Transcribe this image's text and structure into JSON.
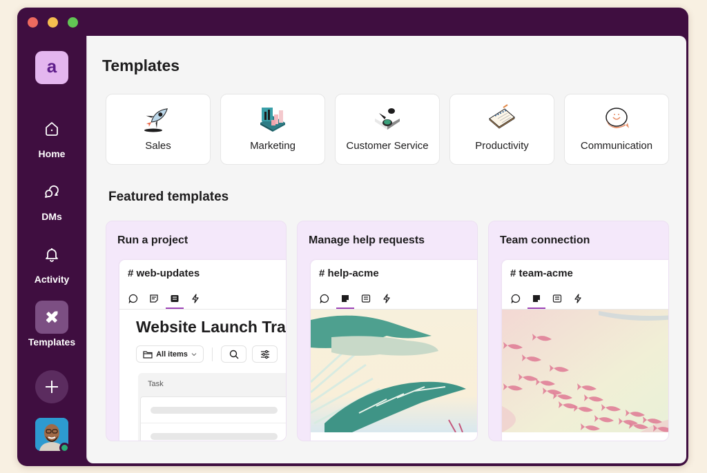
{
  "window": {
    "traffic_lights": [
      "close",
      "minimize",
      "zoom"
    ]
  },
  "sidebar": {
    "workspace_initial": "a",
    "items": [
      {
        "label": "Home",
        "icon": "home-icon",
        "active": false
      },
      {
        "label": "DMs",
        "icon": "dms-icon",
        "active": false
      },
      {
        "label": "Activity",
        "icon": "bell-icon",
        "active": false
      },
      {
        "label": "Templates",
        "icon": "templates-icon",
        "active": true
      }
    ],
    "add_button_icon": "plus-icon",
    "user_status": "online"
  },
  "main": {
    "title": "Templates",
    "categories": [
      {
        "label": "Sales",
        "icon": "rocket-icon"
      },
      {
        "label": "Marketing",
        "icon": "chart-briefcase-icon"
      },
      {
        "label": "Customer Service",
        "icon": "support-icon"
      },
      {
        "label": "Productivity",
        "icon": "notebook-icon"
      },
      {
        "label": "Communication",
        "icon": "chat-bubble-icon"
      }
    ],
    "featured_title": "Featured templates",
    "featured": [
      {
        "title": "Run a project",
        "channel": "# web-updates",
        "active_tab": 2,
        "list_title": "Website Launch Tracker",
        "filter_label": "All items",
        "column_header": "Task"
      },
      {
        "title": "Manage help requests",
        "channel": "# help-acme",
        "active_tab": 1,
        "art": "tropical-leaves"
      },
      {
        "title": "Team connection",
        "channel": "# team-acme",
        "active_tab": 1,
        "art": "pink-fish-school"
      }
    ],
    "preview_tabs": [
      "messages-tab",
      "canvas-tab",
      "list-tab",
      "workflow-tab"
    ]
  },
  "colors": {
    "aubergine": "#3f0e40",
    "workspace_tile": "#e4b6ef",
    "featured_bg": "#f4e8fa",
    "active_tab_underline": "#9c42b6",
    "presence": "#2bac76"
  }
}
